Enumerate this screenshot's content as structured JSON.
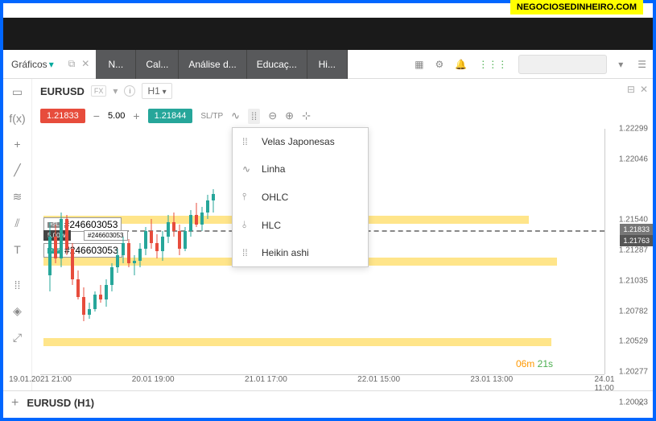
{
  "banner": "NEGOCIOSEDINHEIRO.COM",
  "nav": {
    "graficos": "Gráficos",
    "tabs": [
      "N...",
      "Cal...",
      "Análise d...",
      "Educaç...",
      "Hi..."
    ]
  },
  "header": {
    "symbol": "EURUSD",
    "fx": "FX",
    "timeframe": "H1"
  },
  "toolbar": {
    "sell": "1.21833",
    "lot": "5.00",
    "buy": "1.21844",
    "sltp": "SL/TP"
  },
  "orders": {
    "sl_id": "#246603053",
    "main_id": "#246603053",
    "main_lot": "5.00 ∨",
    "tp_id": "#246603053",
    "sl_tag": "≡SL",
    "tp_tag": "≡TP"
  },
  "dropdown": {
    "items": [
      "Velas Japonesas",
      "Linha",
      "OHLC",
      "HLC",
      "Heikin ashi"
    ]
  },
  "y_axis": [
    "1.22299",
    "1.22046",
    "1.21540",
    "1.21287",
    "1.21035",
    "1.20782",
    "1.20529",
    "1.20277",
    "1.20023"
  ],
  "price_markers": {
    "current": "1.21833",
    "prev": "1.21763"
  },
  "x_axis": [
    "19.01.2021 21:00",
    "20.01 19:00",
    "21.01 17:00",
    "22.01 15:00",
    "23.01 13:00",
    "24.01 11:00"
  ],
  "countdown": {
    "m": "06",
    "mlabel": "m",
    "s": "21",
    "slabel": "s"
  },
  "bottom": {
    "symbol": "EURUSD (H1)"
  },
  "chart_data": {
    "type": "candlestick",
    "symbol": "EURUSD",
    "timeframe": "H1",
    "ylim": [
      1.20023,
      1.22299
    ],
    "series": [
      {
        "t": "19.01 21:00",
        "o": 1.2108,
        "h": 1.2152,
        "l": 1.2095,
        "c": 1.214
      },
      {
        "t": "19.01 22:00",
        "o": 1.214,
        "h": 1.215,
        "l": 1.2118,
        "c": 1.2122
      },
      {
        "t": "19.01 23:00",
        "o": 1.2122,
        "h": 1.216,
        "l": 1.2115,
        "c": 1.2155
      },
      {
        "t": "20.01 00:00",
        "o": 1.2155,
        "h": 1.2158,
        "l": 1.2125,
        "c": 1.213
      },
      {
        "t": "20.01 01:00",
        "o": 1.213,
        "h": 1.2135,
        "l": 1.21,
        "c": 1.2105
      },
      {
        "t": "20.01 02:00",
        "o": 1.2105,
        "h": 1.2112,
        "l": 1.2088,
        "c": 1.209
      },
      {
        "t": "20.01 03:00",
        "o": 1.209,
        "h": 1.2098,
        "l": 1.207,
        "c": 1.2075
      },
      {
        "t": "20.01 04:00",
        "o": 1.2075,
        "h": 1.2085,
        "l": 1.2072,
        "c": 1.208
      },
      {
        "t": "20.01 05:00",
        "o": 1.208,
        "h": 1.2095,
        "l": 1.2078,
        "c": 1.2092
      },
      {
        "t": "20.01 06:00",
        "o": 1.2092,
        "h": 1.21,
        "l": 1.2085,
        "c": 1.2088
      },
      {
        "t": "20.01 07:00",
        "o": 1.2088,
        "h": 1.2105,
        "l": 1.2082,
        "c": 1.21
      },
      {
        "t": "20.01 08:00",
        "o": 1.21,
        "h": 1.2118,
        "l": 1.2095,
        "c": 1.2115
      },
      {
        "t": "20.01 09:00",
        "o": 1.2115,
        "h": 1.213,
        "l": 1.211,
        "c": 1.2125
      },
      {
        "t": "20.01 10:00",
        "o": 1.2125,
        "h": 1.214,
        "l": 1.2118,
        "c": 1.2135
      },
      {
        "t": "20.01 11:00",
        "o": 1.2135,
        "h": 1.2138,
        "l": 1.2115,
        "c": 1.2118
      },
      {
        "t": "20.01 12:00",
        "o": 1.2118,
        "h": 1.2125,
        "l": 1.2108,
        "c": 1.212
      },
      {
        "t": "20.01 13:00",
        "o": 1.212,
        "h": 1.2135,
        "l": 1.2115,
        "c": 1.213
      },
      {
        "t": "20.01 14:00",
        "o": 1.213,
        "h": 1.2148,
        "l": 1.2125,
        "c": 1.2145
      },
      {
        "t": "20.01 15:00",
        "o": 1.2145,
        "h": 1.2155,
        "l": 1.213,
        "c": 1.2135
      },
      {
        "t": "20.01 16:00",
        "o": 1.2135,
        "h": 1.2142,
        "l": 1.2122,
        "c": 1.2128
      },
      {
        "t": "20.01 17:00",
        "o": 1.2128,
        "h": 1.2145,
        "l": 1.212,
        "c": 1.214
      },
      {
        "t": "20.01 18:00",
        "o": 1.214,
        "h": 1.2158,
        "l": 1.2135,
        "c": 1.2152
      },
      {
        "t": "20.01 19:00",
        "o": 1.2152,
        "h": 1.216,
        "l": 1.214,
        "c": 1.2145
      },
      {
        "t": "20.01 20:00",
        "o": 1.2145,
        "h": 1.215,
        "l": 1.2125,
        "c": 1.213
      },
      {
        "t": "20.01 21:00",
        "o": 1.213,
        "h": 1.2148,
        "l": 1.2128,
        "c": 1.2145
      },
      {
        "t": "20.01 22:00",
        "o": 1.2145,
        "h": 1.2162,
        "l": 1.214,
        "c": 1.2158
      },
      {
        "t": "20.01 23:00",
        "o": 1.2158,
        "h": 1.2168,
        "l": 1.2148,
        "c": 1.215
      },
      {
        "t": "21.01 00:00",
        "o": 1.215,
        "h": 1.2165,
        "l": 1.2145,
        "c": 1.216
      },
      {
        "t": "21.01 01:00",
        "o": 1.216,
        "h": 1.2175,
        "l": 1.2155,
        "c": 1.217
      },
      {
        "t": "21.01 02:00",
        "o": 1.217,
        "h": 1.218,
        "l": 1.216,
        "c": 1.2176
      }
    ]
  }
}
